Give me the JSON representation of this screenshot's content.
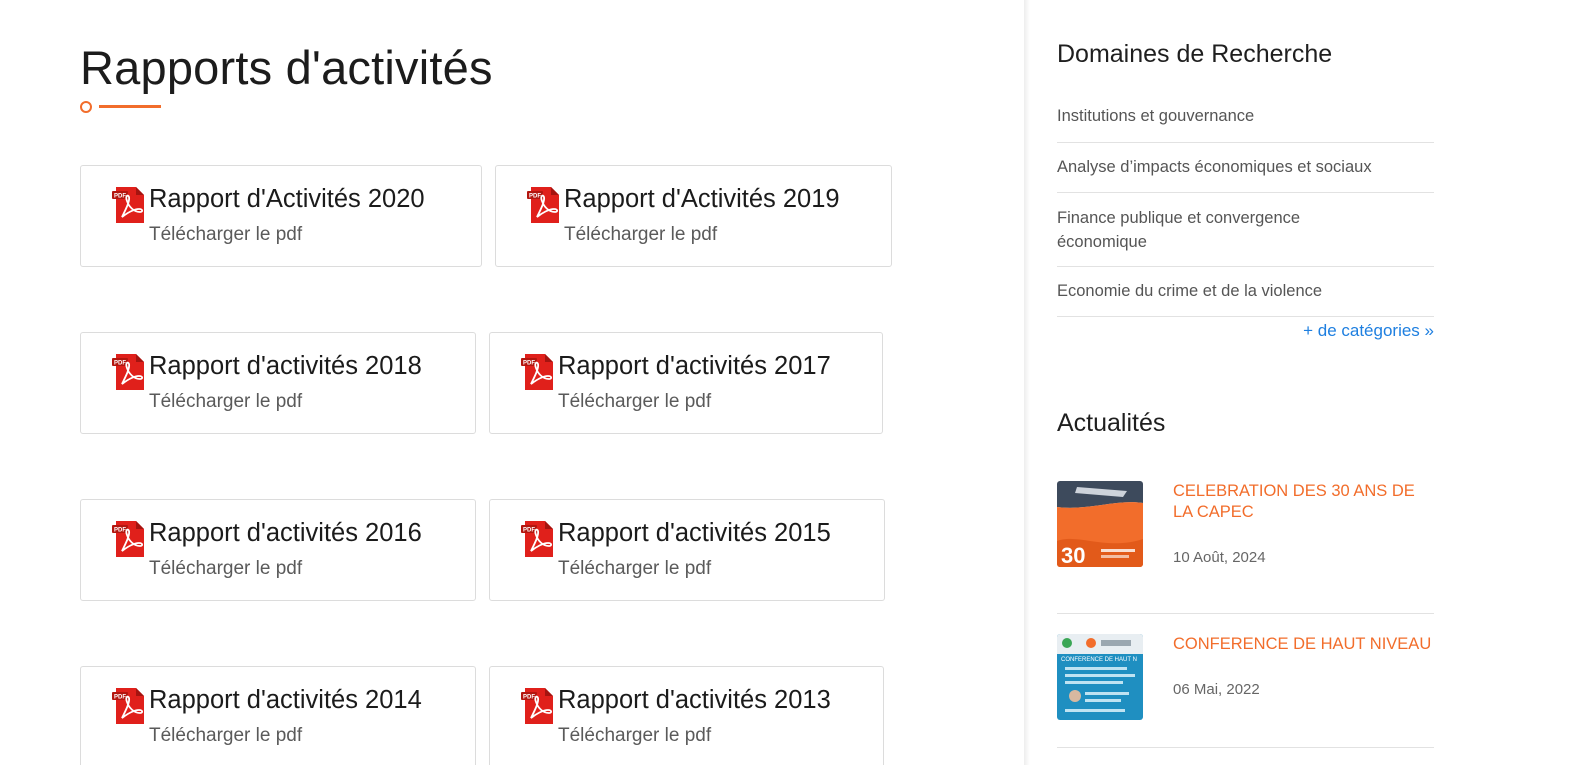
{
  "main": {
    "title": "Rapports d'activités",
    "reports": [
      {
        "title": "Rapport d'Activités 2020",
        "link": "Télécharger le pdf"
      },
      {
        "title": "Rapport d'Activités 2019",
        "link": "Télécharger le pdf"
      },
      {
        "title": "Rapport d'activités 2018",
        "link": "Télécharger le pdf"
      },
      {
        "title": "Rapport d'activités 2017",
        "link": "Télécharger le pdf"
      },
      {
        "title": "Rapport d'activités 2016",
        "link": "Télécharger le pdf"
      },
      {
        "title": "Rapport d'activités 2015",
        "link": "Télécharger le pdf"
      },
      {
        "title": "Rapport d'activités 2014",
        "link": "Télécharger le pdf"
      },
      {
        "title": "Rapport d'activités 2013",
        "link": "Télécharger le pdf"
      }
    ]
  },
  "sidebar": {
    "research_title": "Domaines de Recherche",
    "categories": [
      "Institutions et gouvernance",
      "Analyse d’impacts économiques et sociaux",
      "Finance publique et convergence économique",
      "Economie du crime et de la violence"
    ],
    "more_categories": "+ de catégories »",
    "news_title": "Actualités",
    "news": [
      {
        "title": "CELEBRATION DES 30 ANS DE LA CAPEC",
        "date": "10 Août, 2024",
        "thumb_text": "30"
      },
      {
        "title": "CONFERENCE DE HAUT NIVEAU",
        "date": "06 Mai, 2022",
        "thumb_text": "CONFERENCE DE HAUT N"
      }
    ]
  },
  "colors": {
    "accent": "#f26d2b",
    "link_blue": "#1e7fe0",
    "pdf_red": "#e0201b"
  },
  "icons": [
    "pdf-icon"
  ]
}
